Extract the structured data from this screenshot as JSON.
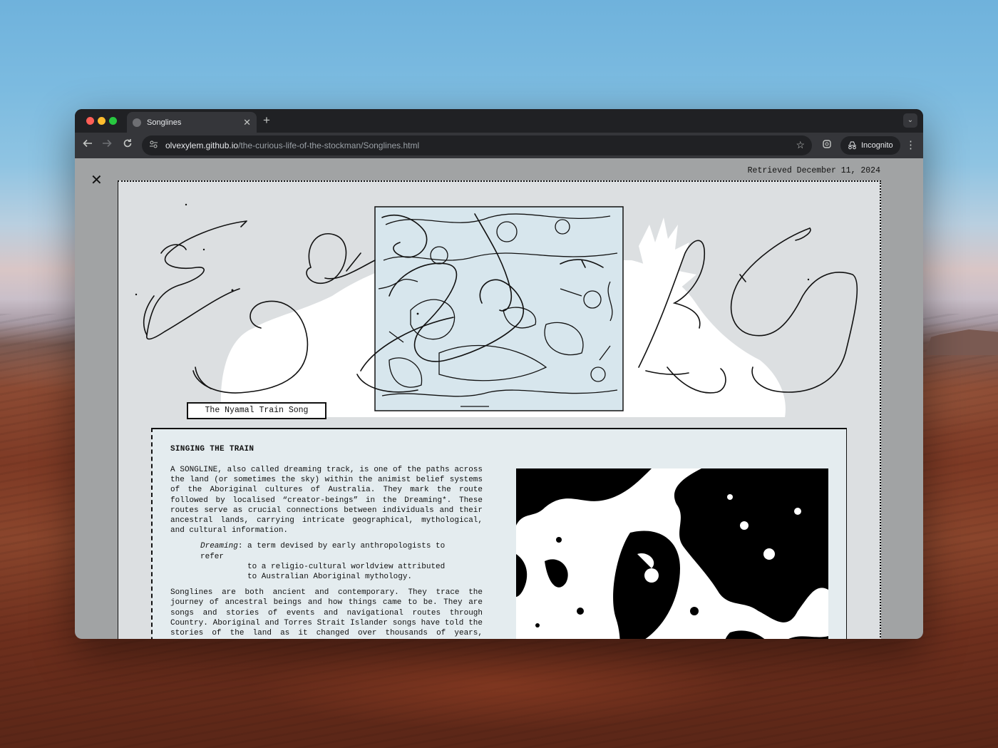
{
  "browser": {
    "tab_title": "Songlines",
    "new_tab_symbol": "+",
    "url_host": "olvexylem.github.io",
    "url_path": "/the-curious-life-of-the-stockman/Songlines.html",
    "incognito_label": "Incognito"
  },
  "page": {
    "retrieved": "Retrieved December 11, 2024",
    "caption": "The Nyamal Train Song",
    "section_heading": "SINGING THE TRAIN",
    "paragraph_1": "A SONGLINE, also called dreaming track, is one of the paths across the land (or sometimes the sky) within the animist belief systems of the Aboriginal cultures of Australia. They mark the route followed by localised “creator-beings” in the Dreaming*. These routes serve as crucial connections between individuals and their ancestral lands, carrying intricate geographical, mythological, and cultural information.",
    "note_term": "Dreaming",
    "note_line_1": ": a term devised by early anthropologists to refer",
    "note_line_2": "to a religio-cultural worldview attributed to Australian Aboriginal mythology.",
    "paragraph_2": "Songlines are both ancient and contemporary. They trace the journey of ancestral beings and how things came to be. They are songs and stories of events and navigational routes through Country. Aboriginal and Torres Strait Islander songs have told the stories of the land as it changed over thousands of years, transforming into ranges, rivers and water holes. They have sung into being people's culture and their connection to country as a living thing. Songs like"
  },
  "icons": {
    "close": "close-icon",
    "back": "arrow-left-icon",
    "forward": "arrow-right-icon",
    "reload": "reload-icon",
    "star": "star-icon",
    "incognito": "incognito-icon",
    "menu": "kebab-menu-icon"
  }
}
